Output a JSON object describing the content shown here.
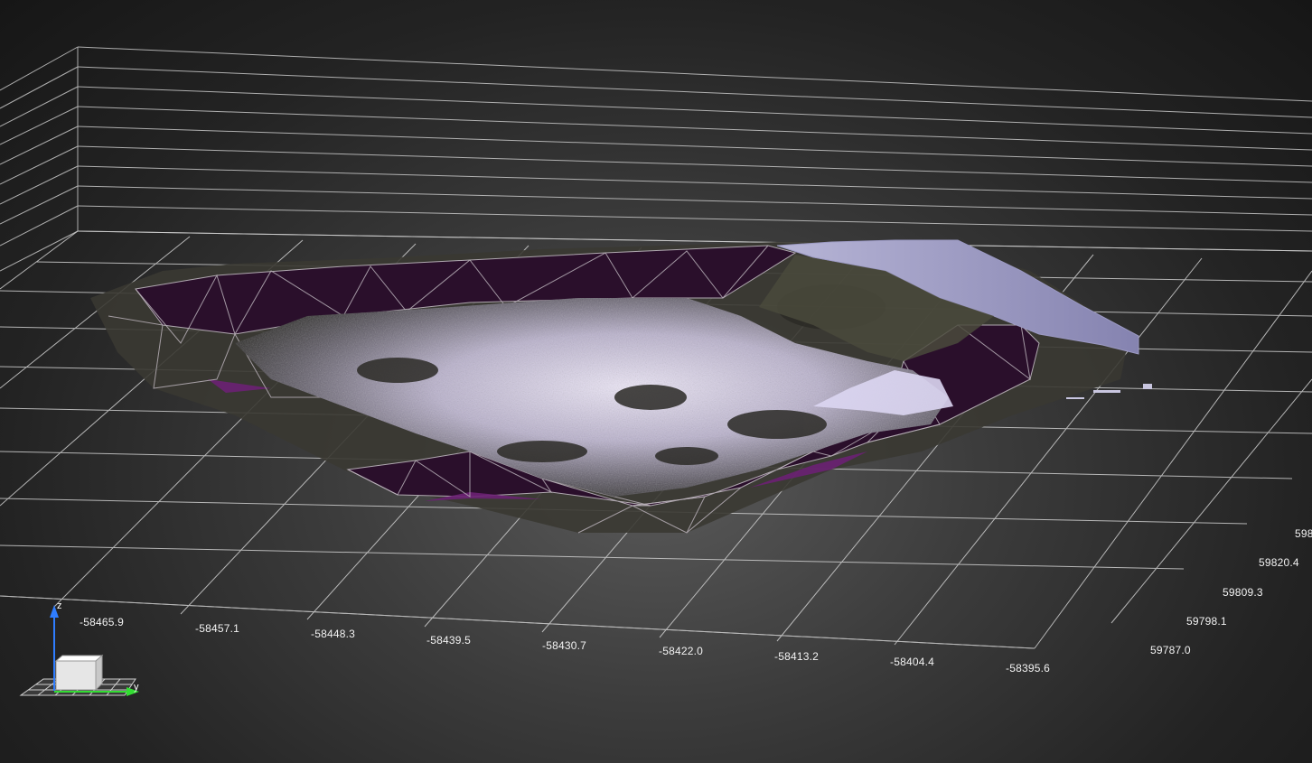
{
  "viewer": {
    "x_axis_ticks": [
      "-58465.9",
      "-58457.1",
      "-58448.3",
      "-58439.5",
      "-58430.7",
      "-58422.0",
      "-58413.2",
      "-58404.4",
      "-58395.6"
    ],
    "y_axis_ticks": [
      "59787.0",
      "59798.1",
      "59809.3",
      "59820.4",
      "598"
    ],
    "triad": {
      "z_label": "z",
      "y_label": "y",
      "z_color": "#2f7dff",
      "y_color": "#33dd33"
    }
  },
  "colors": {
    "grid": "#c8c8c8",
    "mesh_fill": "#2a0f2b",
    "mesh_fill_bright": "#5d1f66",
    "mesh_edges": "#b0a8b0",
    "point_cloud_light": "#d9d0ee",
    "point_cloud_dark": "#2b2a26"
  }
}
